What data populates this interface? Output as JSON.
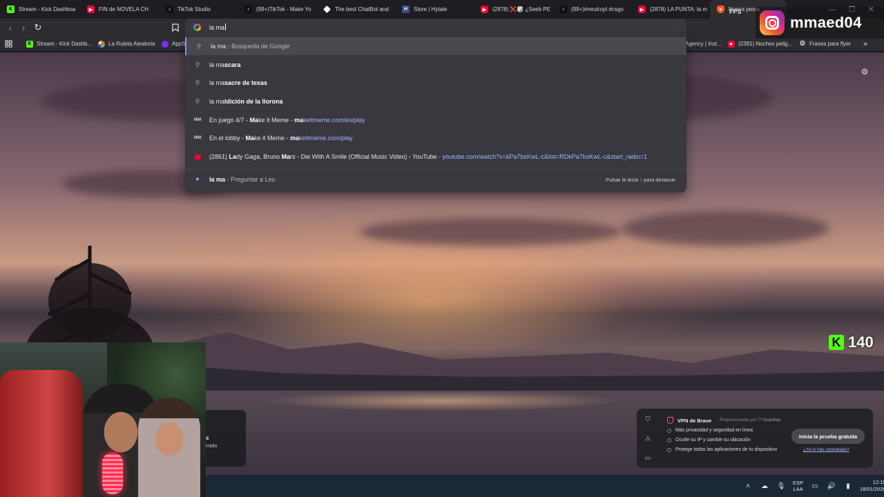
{
  "tabs": [
    {
      "label": "Stream - Kick Dashboa",
      "icon": "kick-icon"
    },
    {
      "label": "FIN de NOVELA CH",
      "icon": "youtube-icon"
    },
    {
      "label": "TikTok Studio",
      "icon": "tiktok-icon"
    },
    {
      "label": "(99+)TikTok - Make Yo",
      "icon": "tiktok-icon"
    },
    {
      "label": "The best ChatBot and",
      "icon": "diamond-icon"
    },
    {
      "label": "Store | Hytale",
      "icon": "store-icon"
    },
    {
      "label": "(2878) ❌🎲 ¿Seeb PE",
      "icon": "youtube-icon"
    },
    {
      "label": "(99+)#neutroyt #csgo",
      "icon": "tiktok-icon"
    },
    {
      "label": "(2878) LA PUNTA: la m",
      "icon": "youtube-icon"
    },
    {
      "label": "Nueva pesta",
      "icon": "brave-icon"
    }
  ],
  "omnibox": {
    "query": "la ma"
  },
  "bookmarks": [
    {
      "label": "Stream - Kick Dashb...",
      "icon": "kick-icon"
    },
    {
      "label": "La Ruleta Aleatoria",
      "icon": "roulette-icon"
    },
    {
      "label": "AppS",
      "icon": "apps-icon"
    },
    {
      "label": "Agency | Inst...",
      "icon": "instagram-icon"
    },
    {
      "label": "(2391) Noches pelig...",
      "icon": "youtube-icon"
    },
    {
      "label": "Frases para flyer",
      "icon": "gear-icon"
    }
  ],
  "suggestions": [
    {
      "icon": "search-icon",
      "prefix": "la ma",
      "bold": "",
      "sub": " - Búsqueda de Google",
      "url": ""
    },
    {
      "icon": "search-icon",
      "prefix": "la ma",
      "bold": "scara",
      "sub": "",
      "url": ""
    },
    {
      "icon": "search-icon",
      "prefix": "la ma",
      "bold": "sacre de texas",
      "sub": "",
      "url": ""
    },
    {
      "icon": "search-icon",
      "prefix": "la ma",
      "bold": "ldición de la llorona",
      "sub": "",
      "url": ""
    },
    {
      "icon": "makeitmeme-icon",
      "pre": "En juego 4/7 - ",
      "boldA": "Ma",
      "mid": "ke it Meme - ",
      "boldB": "ma",
      "urlrest": "keitmeme.com/es/play"
    },
    {
      "icon": "makeitmeme-icon",
      "pre": "En el lobby - ",
      "boldA": "Ma",
      "mid": "ke it Meme - ",
      "boldB": "ma",
      "urlrest": "keitmeme.com/play"
    },
    {
      "icon": "youtube-icon",
      "pre": "(2861) ",
      "boldA": "La",
      "mid": "dy Gaga, Bruno ",
      "boldB": "Ma",
      "rest": "rs - Die With A Smile (Official Music Video) - YouTube",
      "url": " - youtube.com/watch?v=kPa7bsKwL-c&list=RDkPa7bsKwL-c&start_radio=1"
    }
  ],
  "leo": {
    "bold": "la ma",
    "label": " - Preguntar a Leo",
    "hint": "Pulsar la tecla ↑ para destacar"
  },
  "overlay": {
    "instagram_handle": "mmaed04",
    "fps_text": "FPS",
    "kick_letter": "K",
    "kick_count": "140"
  },
  "webcam_panel": {
    "line1": "s",
    "line2": "rrado"
  },
  "vpn": {
    "title": "VPN de Brave",
    "powered_by": "Proporcionado por",
    "provider": "Guardian",
    "features": [
      "Más privacidad y seguridad en línea",
      "Oculte su IP y cambie su ubicación",
      "Protege todas las aplicaciones de tu dispositivo"
    ],
    "cta": "Inicia la prueba gratuita",
    "already": "¿Ya lo has contratado?"
  },
  "taskbar": {
    "lang_top": "ESP",
    "lang_bottom": "LAA",
    "time": "12:15",
    "date": "18/01/2026"
  }
}
